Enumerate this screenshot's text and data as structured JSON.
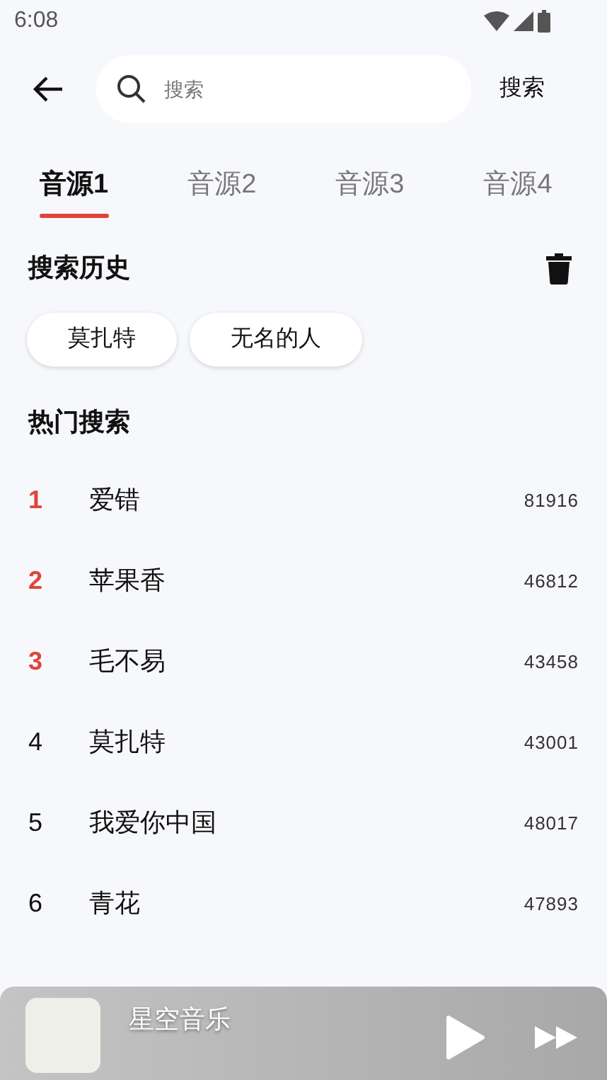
{
  "status_bar": {
    "time": "6:08"
  },
  "search": {
    "placeholder": "搜索",
    "button": "搜索"
  },
  "tabs": [
    {
      "label": "音源1",
      "selected": true
    },
    {
      "label": "音源2",
      "selected": false
    },
    {
      "label": "音源3",
      "selected": false
    },
    {
      "label": "音源4",
      "selected": false
    }
  ],
  "history": {
    "title": "搜索历史",
    "items": [
      "莫扎特",
      "无名的人"
    ]
  },
  "hot": {
    "title": "热门搜索",
    "items": [
      {
        "rank": "1",
        "name": "爱错",
        "count": "81916",
        "highlighted": true
      },
      {
        "rank": "2",
        "name": "苹果香",
        "count": "46812",
        "highlighted": true
      },
      {
        "rank": "3",
        "name": "毛不易",
        "count": "43458",
        "highlighted": true
      },
      {
        "rank": "4",
        "name": "莫扎特",
        "count": "43001",
        "highlighted": false
      },
      {
        "rank": "5",
        "name": "我爱你中国",
        "count": "48017",
        "highlighted": false
      },
      {
        "rank": "6",
        "name": "青花",
        "count": "47893",
        "highlighted": false
      }
    ]
  },
  "player": {
    "title": "星空音乐"
  }
}
